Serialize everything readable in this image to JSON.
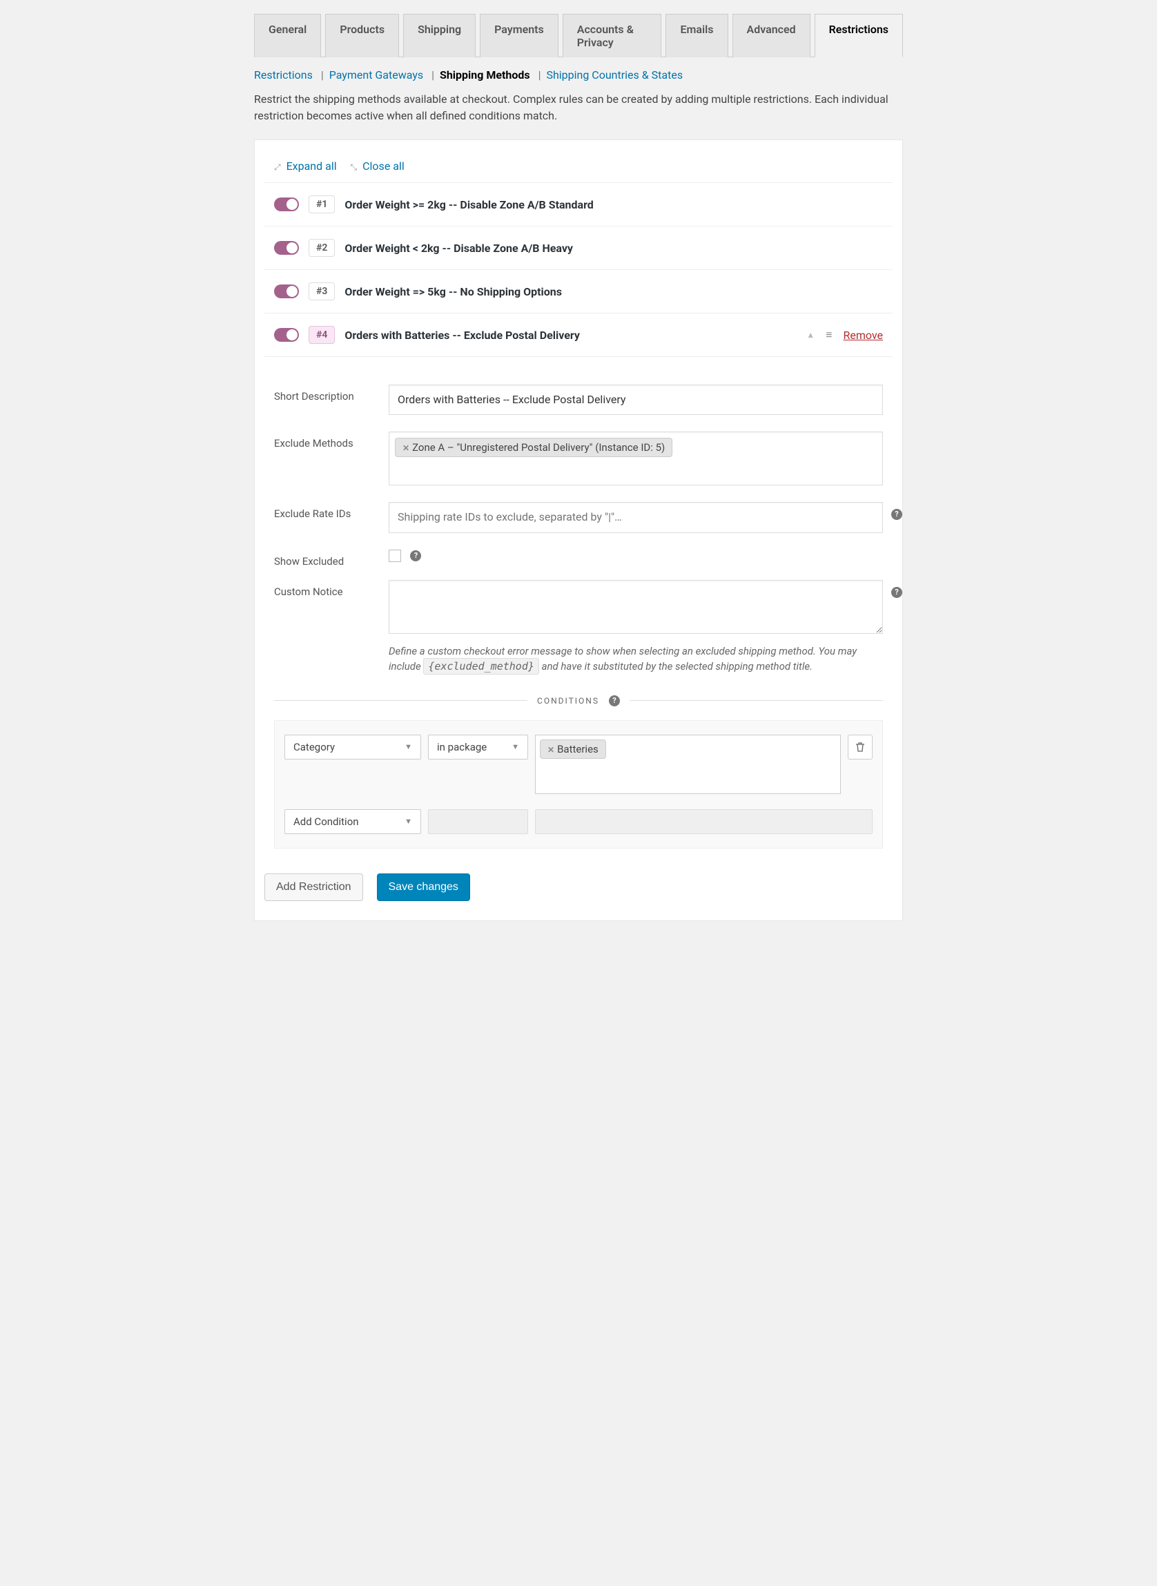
{
  "tabs": [
    "General",
    "Products",
    "Shipping",
    "Payments",
    "Accounts & Privacy",
    "Emails",
    "Advanced",
    "Restrictions"
  ],
  "active_tab": "Restrictions",
  "subnav": {
    "items": [
      "Restrictions",
      "Payment Gateways",
      "Shipping Methods",
      "Shipping Countries & States"
    ],
    "current": "Shipping Methods"
  },
  "description": "Restrict the shipping methods available at checkout. Complex rules can be created by adding multiple restrictions. Each individual restriction becomes active when all defined conditions match.",
  "toolbar": {
    "expand": "Expand all",
    "close": "Close all"
  },
  "restrictions": [
    {
      "id": "#1",
      "title": "Order Weight >= 2kg -- Disable Zone A/B Standard"
    },
    {
      "id": "#2",
      "title": "Order Weight < 2kg -- Disable Zone A/B Heavy"
    },
    {
      "id": "#3",
      "title": "Order Weight => 5kg -- No Shipping Options"
    },
    {
      "id": "#4",
      "title": "Orders with Batteries -- Exclude Postal Delivery",
      "open": true
    }
  ],
  "remove_label": "Remove",
  "form": {
    "short_description": {
      "label": "Short Description",
      "value": "Orders with Batteries -- Exclude Postal Delivery"
    },
    "exclude_methods": {
      "label": "Exclude Methods",
      "chip": "Zone A – \"Unregistered Postal Delivery\" (Instance ID: 5)"
    },
    "exclude_rate_ids": {
      "label": "Exclude Rate IDs",
      "placeholder": "Shipping rate IDs to exclude, separated by \"|\"…"
    },
    "show_excluded": {
      "label": "Show Excluded"
    },
    "custom_notice": {
      "label": "Custom Notice",
      "desc_pre": "Define a custom checkout error message to show when selecting an excluded shipping method. You may include ",
      "desc_code": "{excluded_method}",
      "desc_post": " and have it substituted by the selected shipping method title."
    }
  },
  "conditions_header": "CONDITIONS",
  "condition": {
    "type": "Category",
    "modifier": "in package",
    "value": "Batteries"
  },
  "add_condition": "Add Condition",
  "buttons": {
    "add": "Add Restriction",
    "save": "Save changes"
  }
}
